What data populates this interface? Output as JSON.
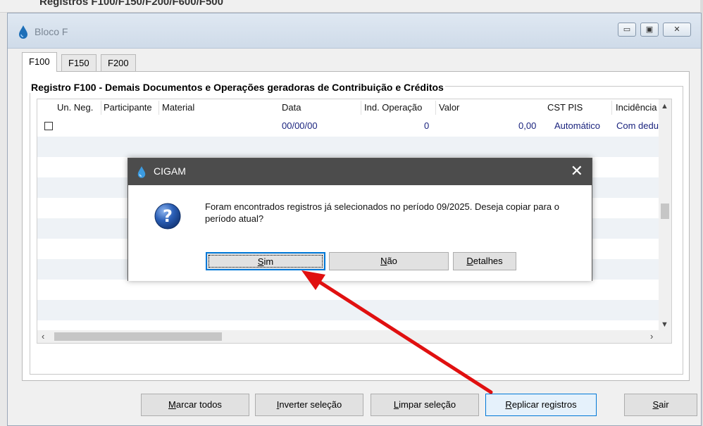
{
  "background_window": {
    "title_text": "Registros F100/F150/F200/F600/F500"
  },
  "window": {
    "title": "Bloco F",
    "controls": {
      "minimize": "▭",
      "restore": "▣",
      "close": "✕"
    }
  },
  "tabs": [
    {
      "label": "F100",
      "active": true
    },
    {
      "label": "F150",
      "active": false
    },
    {
      "label": "F200",
      "active": false
    }
  ],
  "group": {
    "title": "Registro F100 - Demais Documentos e Operações geradoras de Contribuição e Créditos"
  },
  "grid": {
    "columns": [
      "Un. Neg.",
      "Participante",
      "Material",
      "Data",
      "Ind. Operação",
      "Valor",
      "CST PIS",
      "Incidência"
    ],
    "rows": [
      {
        "checked": false,
        "un_neg": "",
        "participante": "",
        "material": "",
        "data": "00/00/00",
        "ind_operacao": "0",
        "valor": "0,00",
        "cst_pis": "Automático",
        "incidencia": "Com dedu"
      }
    ]
  },
  "buttons": {
    "marcar_todos": {
      "mnemonic": "M",
      "rest": "arcar todos"
    },
    "inverter_selecao": {
      "mnemonic": "I",
      "rest": "nverter seleção"
    },
    "limpar_selecao": {
      "mnemonic": "L",
      "rest": "impar seleção"
    },
    "replicar_registros": {
      "mnemonic": "R",
      "rest": "eplicar registros"
    },
    "sair": {
      "mnemonic": "S",
      "rest": "air"
    }
  },
  "dialog": {
    "title": "CIGAM",
    "close": "✕",
    "message": "Foram encontrados registros já selecionados no período 09/2025. Deseja copiar para o período atual?",
    "buttons": {
      "sim": {
        "mnemonic": "S",
        "rest": "im"
      },
      "nao": {
        "mnemonic": "N",
        "rest": "ão"
      },
      "detalhes": {
        "mnemonic": "D",
        "rest": "etalhes"
      }
    }
  },
  "colors": {
    "annotation_arrow": "#e01010",
    "grid_text": "#1a237e",
    "dialog_titlebar": "#4c4c4c",
    "focus_border": "#0078d7"
  },
  "icons": {
    "app": "water-drop-icon",
    "question": "question-icon"
  }
}
